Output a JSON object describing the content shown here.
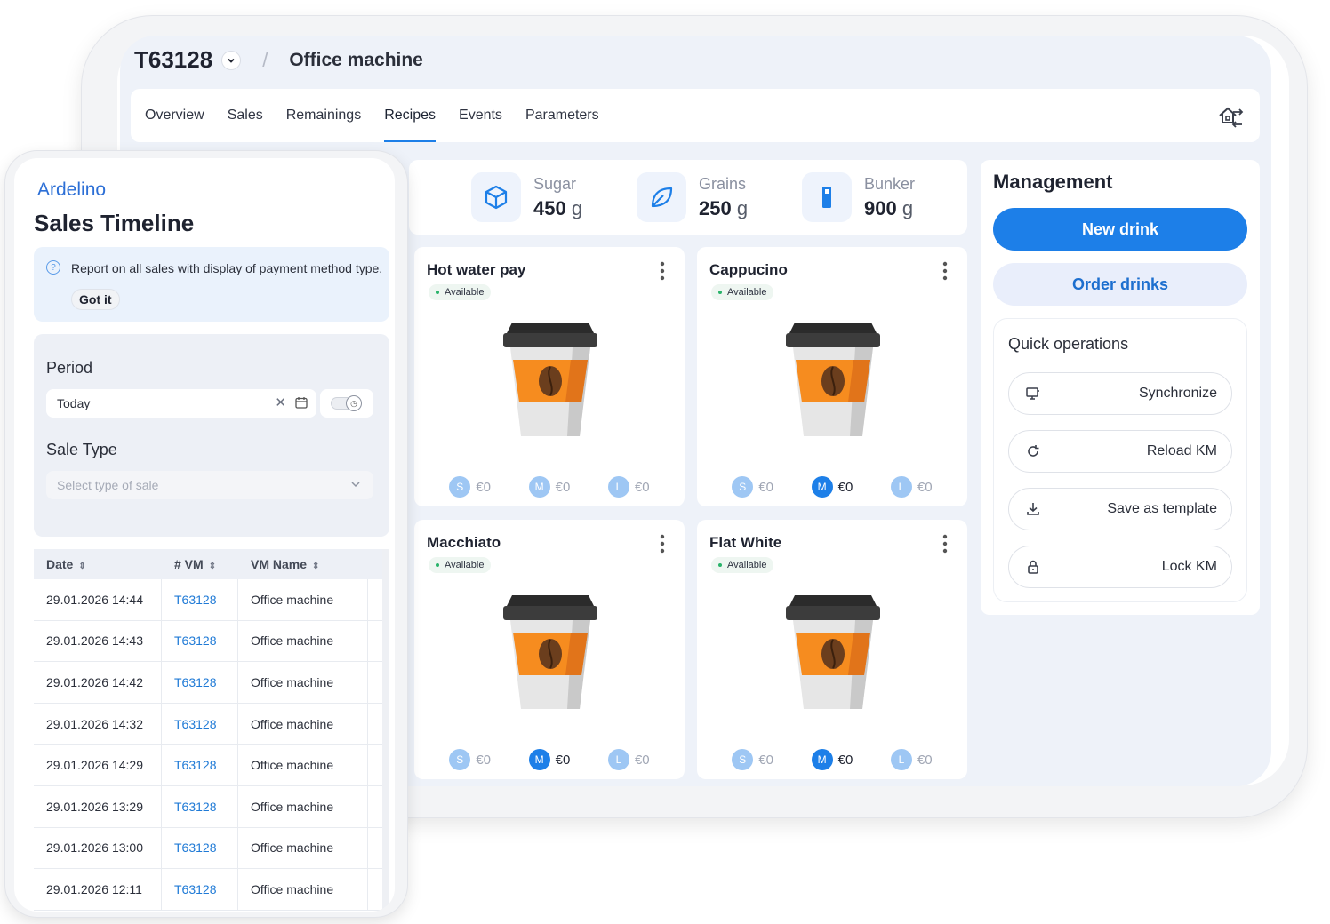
{
  "header": {
    "machine_id": "T63128",
    "separator": "/",
    "machine_name": "Office machine"
  },
  "tabs": [
    {
      "label": "Overview"
    },
    {
      "label": "Sales"
    },
    {
      "label": "Remainings"
    },
    {
      "label": "Recipes",
      "active": true
    },
    {
      "label": "Events"
    },
    {
      "label": "Parameters"
    }
  ],
  "stats": [
    {
      "label": "Sugar",
      "value": "450",
      "unit": "g",
      "icon": "cube-icon"
    },
    {
      "label": "Grains",
      "value": "250",
      "unit": "g",
      "icon": "leaf-icon"
    },
    {
      "label": "Bunker",
      "value": "900",
      "unit": "g",
      "icon": "bunker-icon"
    }
  ],
  "drinks": [
    {
      "name": "Hot water pay",
      "status": "Available",
      "sizes": [
        {
          "s": "S",
          "price": "€0"
        },
        {
          "s": "M",
          "price": "€0"
        },
        {
          "s": "L",
          "price": "€0"
        }
      ],
      "active_size": "none"
    },
    {
      "name": "Cappucino",
      "status": "Available",
      "sizes": [
        {
          "s": "S",
          "price": "€0"
        },
        {
          "s": "M",
          "price": "€0"
        },
        {
          "s": "L",
          "price": "€0"
        }
      ],
      "active_size": "M"
    },
    {
      "name": "Macchiato",
      "status": "Available",
      "sizes": [
        {
          "s": "S",
          "price": "€0"
        },
        {
          "s": "M",
          "price": "€0"
        },
        {
          "s": "L",
          "price": "€0"
        }
      ],
      "active_size": "M"
    },
    {
      "name": "Flat White",
      "status": "Available",
      "sizes": [
        {
          "s": "S",
          "price": "€0"
        },
        {
          "s": "M",
          "price": "€0"
        },
        {
          "s": "L",
          "price": "€0"
        }
      ],
      "active_size": "M"
    }
  ],
  "management": {
    "title": "Management",
    "new_drink": "New drink",
    "order_drinks": "Order drinks",
    "quick_title": "Quick operations",
    "quick": [
      {
        "label": "Synchronize",
        "icon": "sync-device-icon"
      },
      {
        "label": "Reload KM",
        "icon": "reload-icon"
      },
      {
        "label": "Save as template",
        "icon": "download-icon"
      },
      {
        "label": "Lock KM",
        "icon": "lock-icon"
      }
    ]
  },
  "phone": {
    "brand": "Ardelino",
    "title": "Sales Timeline",
    "info_text": "Report on all sales with display of payment method type.",
    "got_it": "Got it",
    "period_label": "Period",
    "period_value": "Today",
    "sale_type_label": "Sale Type",
    "sale_type_placeholder": "Select type of sale",
    "columns": [
      "Date",
      "# VM",
      "VM Name"
    ],
    "rows": [
      [
        "29.01.2026 14:44",
        "T63128",
        "Office machine"
      ],
      [
        "29.01.2026 14:43",
        "T63128",
        "Office machine"
      ],
      [
        "29.01.2026 14:42",
        "T63128",
        "Office machine"
      ],
      [
        "29.01.2026 14:32",
        "T63128",
        "Office machine"
      ],
      [
        "29.01.2026 14:29",
        "T63128",
        "Office machine"
      ],
      [
        "29.01.2026 13:29",
        "T63128",
        "Office machine"
      ],
      [
        "29.01.2026 13:00",
        "T63128",
        "Office machine"
      ],
      [
        "29.01.2026 12:11",
        "T63128",
        "Office machine"
      ]
    ]
  },
  "colors": {
    "accent": "#1d7fe8",
    "link": "#1f7ad6",
    "available": "#29b36a"
  }
}
